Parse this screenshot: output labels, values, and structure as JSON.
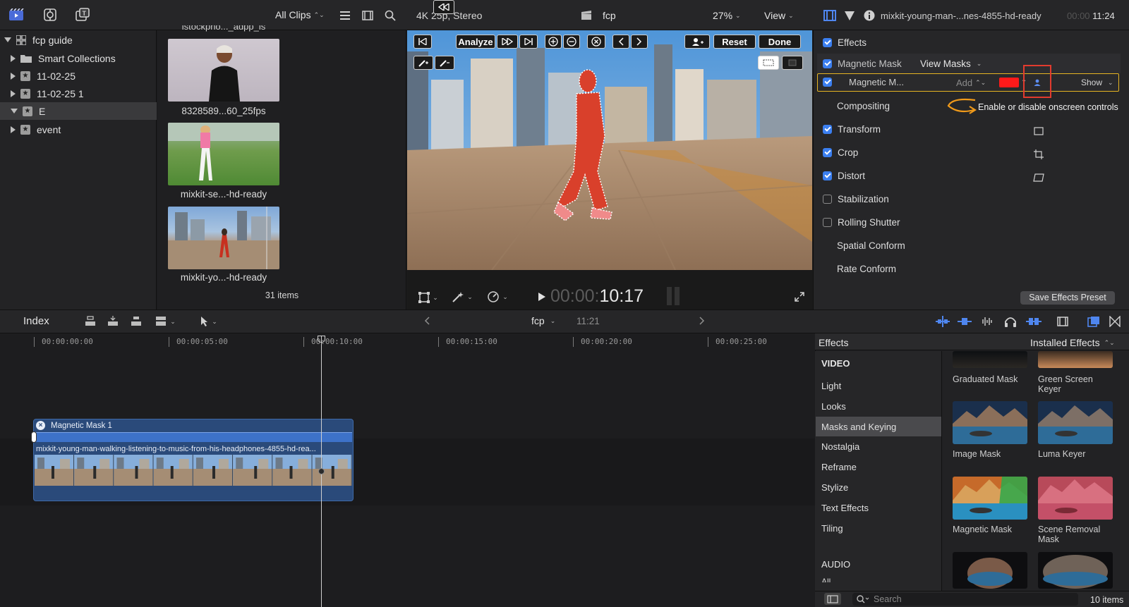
{
  "toolbar": {
    "clips_filter": "All Clips",
    "viewer_format": "4K 25p, Stereo",
    "project_name": "fcp",
    "zoom": "27%",
    "view_menu": "View",
    "inspector_clip_name": "mixkit-young-man-...nes-4855-hd-ready",
    "inspector_timecode_dim": "00:00",
    "inspector_timecode": "11:24"
  },
  "library": {
    "items": [
      {
        "label": "fcp guide",
        "level": 0,
        "expanded": true
      },
      {
        "label": "Smart Collections",
        "level": 1
      },
      {
        "label": "11-02-25",
        "level": 1
      },
      {
        "label": "11-02-25 1",
        "level": 1
      },
      {
        "label": "E",
        "level": 1,
        "selected": true,
        "expanded": true
      },
      {
        "label": "event",
        "level": 1
      }
    ]
  },
  "browser": {
    "partial_caption": "istockpho..._adpp_is",
    "clips": [
      {
        "caption": "8328589...60_25fps"
      },
      {
        "caption": "mixkit-se...-hd-ready"
      },
      {
        "caption": "mixkit-yo...-hd-ready"
      }
    ],
    "item_count": "31 items"
  },
  "viewer": {
    "analyze_label": "Analyze",
    "reset_label": "Reset",
    "done_label": "Done",
    "timecode_dim": "00:00:",
    "timecode": "10:17"
  },
  "inspector": {
    "effects_label": "Effects",
    "magnetic_mask_label": "Magnetic Mask",
    "view_masks_label": "View Masks",
    "mask_row_label": "Magnetic M...",
    "add_label": "Add",
    "show_label": "Show",
    "mask_color": "#ff1a1a",
    "tooltip": "Enable or disable onscreen controls",
    "rows": [
      {
        "label": "Compositing",
        "checkbox": "none"
      },
      {
        "label": "Transform",
        "checkbox": "on"
      },
      {
        "label": "Crop",
        "checkbox": "on"
      },
      {
        "label": "Distort",
        "checkbox": "on"
      },
      {
        "label": "Stabilization",
        "checkbox": "off"
      },
      {
        "label": "Rolling Shutter",
        "checkbox": "off"
      },
      {
        "label": "Spatial Conform",
        "checkbox": "none"
      },
      {
        "label": "Rate Conform",
        "checkbox": "none"
      }
    ],
    "save_preset_label": "Save Effects Preset"
  },
  "timeline": {
    "index_label": "Index",
    "project_name": "fcp",
    "duration": "11:21",
    "ruler": [
      "00:00:00:00",
      "00:00:05:00",
      "00:00:10:00",
      "00:00:15:00",
      "00:00:20:00",
      "00:00:25:00"
    ],
    "effect_clip_label": "Magnetic Mask 1",
    "clip_name": "mixkit-young-man-walking-listening-to-music-from-his-headphones-4855-hd-rea..."
  },
  "effects_browser": {
    "title": "Effects",
    "source": "Installed Effects",
    "video_header": "VIDEO",
    "categories": [
      "Light",
      "Looks",
      "Masks and Keying",
      "Nostalgia",
      "Reframe",
      "Stylize",
      "Text Effects",
      "Tiling"
    ],
    "selected_category": "Masks and Keying",
    "audio_header": "AUDIO",
    "audio_partial": "All",
    "effects": [
      {
        "name": "Graduated Mask"
      },
      {
        "name": "Green Screen Keyer"
      },
      {
        "name": "Image Mask"
      },
      {
        "name": "Luma Keyer"
      },
      {
        "name": "Magnetic Mask"
      },
      {
        "name": "Scene Removal Mask"
      }
    ],
    "search_placeholder": "Search",
    "item_count": "10 items"
  },
  "colors": {
    "accent_blue": "#3b7ff0",
    "highlight_yellow": "#e6b422",
    "callout_red": "#e23b2e",
    "arrow_orange": "#f09a1a"
  }
}
